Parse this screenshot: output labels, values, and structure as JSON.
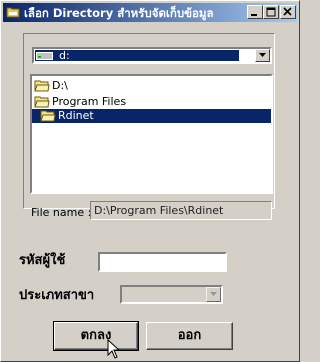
{
  "window": {
    "title": "เลือก Directory สำหรับจัดเก็บข้อมูล",
    "icon": "folder-app-icon",
    "controls": [
      "minimize-icon",
      "maximize-icon",
      "close-icon"
    ]
  },
  "drive_select": {
    "value": "d:",
    "icon": "drive-icon"
  },
  "directory_list": {
    "items": [
      {
        "label": "D:\\",
        "icon": "open-folder-icon",
        "selected": false
      },
      {
        "label": "Program Files",
        "icon": "open-folder-icon",
        "selected": false
      },
      {
        "label": "Rdinet",
        "icon": "open-folder-icon",
        "selected": true
      }
    ]
  },
  "file_name": {
    "label": "File name :",
    "value": "D:\\Program Files\\Rdinet"
  },
  "user_code": {
    "label": "รหัสผู้ใช้",
    "value": ""
  },
  "tax_type": {
    "label": "ประเภทสาขา",
    "value": ""
  },
  "buttons": {
    "ok": "ตกลง",
    "exit": "ออก"
  },
  "colors": {
    "title_start": "#0a246a",
    "title_end": "#a6caf0",
    "selection": "#0a246a",
    "face": "#d4d0c8"
  }
}
